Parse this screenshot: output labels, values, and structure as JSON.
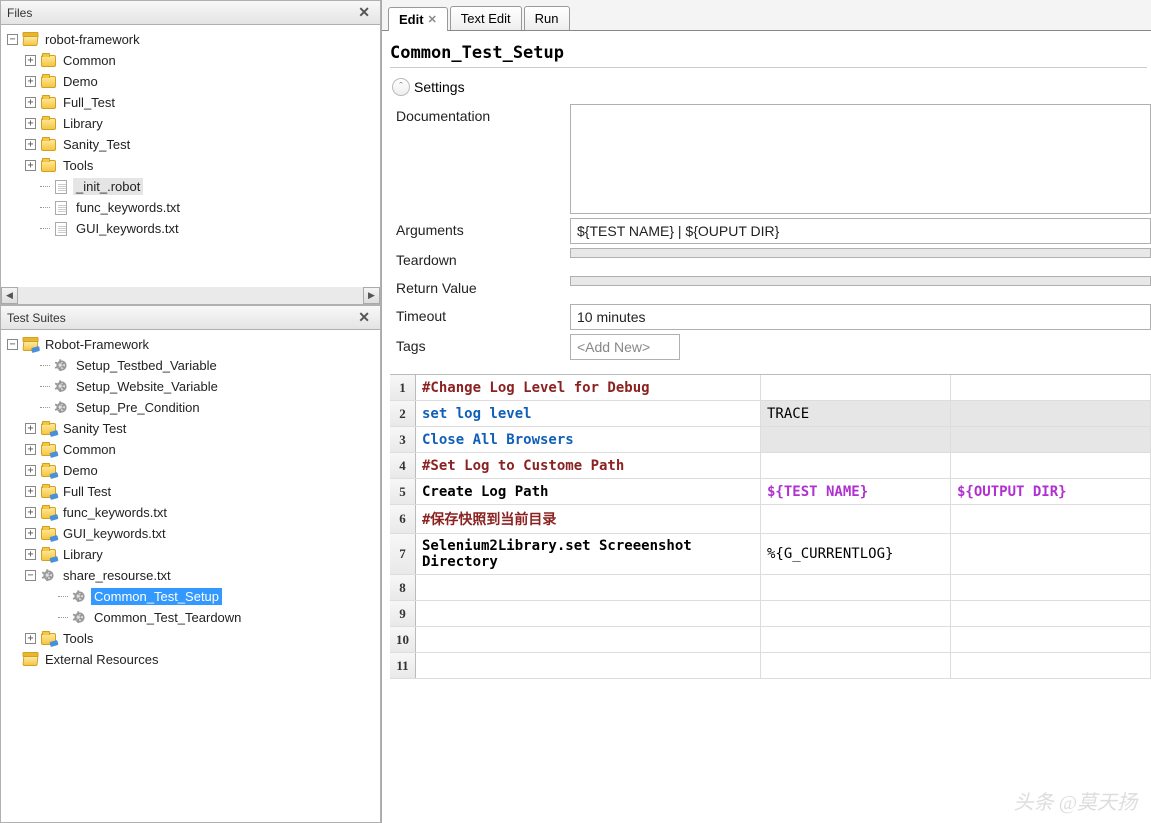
{
  "panels": {
    "files_title": "Files",
    "suites_title": "Test Suites"
  },
  "files_tree": {
    "root": "robot-framework",
    "children": [
      "Common",
      "Demo",
      "Full_Test",
      "Library",
      "Sanity_Test",
      "Tools"
    ],
    "files": [
      "_init_.robot",
      "func_keywords.txt",
      "GUI_keywords.txt"
    ]
  },
  "suites_tree": {
    "root": "Robot-Framework",
    "setups": [
      "Setup_Testbed_Variable",
      "Setup_Website_Variable",
      "Setup_Pre_Condition"
    ],
    "folders": [
      "Sanity Test",
      "Common",
      "Demo",
      "Full Test",
      "func_keywords.txt",
      "GUI_keywords.txt",
      "Library"
    ],
    "share": {
      "file": "share_resourse.txt",
      "children": [
        "Common_Test_Setup",
        "Common_Test_Teardown"
      ]
    },
    "tools": "Tools",
    "external": "External Resources",
    "selected": "Common_Test_Setup"
  },
  "tabs": [
    {
      "label": "Edit",
      "active": true,
      "closable": true
    },
    {
      "label": "Text Edit",
      "active": false
    },
    {
      "label": "Run",
      "active": false
    }
  ],
  "editor": {
    "title": "Common_Test_Setup",
    "settings_label": "Settings",
    "fields": {
      "doc_label": "Documentation",
      "doc_value": "",
      "args_label": "Arguments",
      "args_value": "${TEST NAME} | ${OUPUT DIR}",
      "teardown_label": "Teardown",
      "teardown_value": "",
      "return_label": "Return Value",
      "return_value": "",
      "timeout_label": "Timeout",
      "timeout_value": "10 minutes",
      "tags_label": "Tags",
      "tags_placeholder": "<Add New>"
    },
    "rows": [
      {
        "n": "1",
        "c1": "#Change Log Level for Debug",
        "cls": "cmt",
        "c2": "",
        "c3": ""
      },
      {
        "n": "2",
        "c1": "set log level",
        "cls": "kw",
        "c2": "TRACE",
        "c3": "",
        "shade23": true
      },
      {
        "n": "3",
        "c1": "Close All Browsers",
        "cls": "kw",
        "c2": "",
        "c3": "",
        "shade23": true
      },
      {
        "n": "4",
        "c1": "#Set Log to Custome Path",
        "cls": "cmt",
        "c2": "",
        "c3": ""
      },
      {
        "n": "5",
        "c1": "Create Log Path",
        "cls": "",
        "bold": true,
        "c2": "${TEST NAME}",
        "c3": "${OUTPUT DIR}",
        "varcols": true
      },
      {
        "n": "6",
        "c1": "#保存快照到当前目录",
        "cls": "cmt",
        "c2": "",
        "c3": ""
      },
      {
        "n": "7",
        "c1": "Selenium2Library.set Screeenshot Directory",
        "cls": "",
        "bold": true,
        "c2": "%{G_CURRENTLOG}",
        "c3": ""
      },
      {
        "n": "8",
        "c1": "",
        "c2": "",
        "c3": ""
      },
      {
        "n": "9",
        "c1": "",
        "c2": "",
        "c3": ""
      },
      {
        "n": "10",
        "c1": "",
        "c2": "",
        "c3": ""
      },
      {
        "n": "11",
        "c1": "",
        "c2": "",
        "c3": ""
      }
    ]
  },
  "watermark": "头条 @莫天扬"
}
